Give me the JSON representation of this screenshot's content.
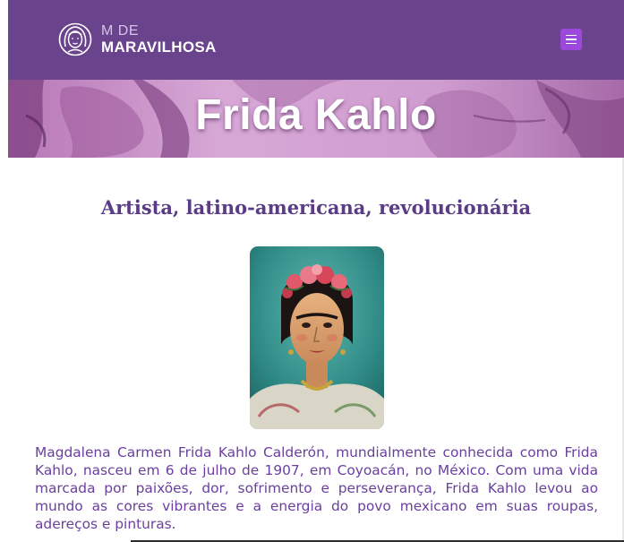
{
  "header": {
    "logo_top": "M DE",
    "logo_bottom": "MARAVILHOSA",
    "menu_icon": "hamburger-icon"
  },
  "banner": {
    "title": "Frida Kahlo"
  },
  "main": {
    "subtitle": "Artista, latino-americana, revolucionária",
    "bio": "Magdalena Carmen Frida Kahlo Calderón, mundialmente conhecida como Frida Kahlo, nasceu em 6 de julho de 1907, em Coyoacán, no México. Com uma vida marcada por paixões, dor, sofrimento e perseverança, Frida Kahlo levou ao mundo as cores vibrantes e a energia do povo mexicano em suas roupas, adereços e pinturas."
  },
  "colors": {
    "header_bg": "#6a438d",
    "menu_button": "#9a49dc",
    "accent_text": "#5a3b86",
    "bio_text": "#6a3fa0"
  }
}
